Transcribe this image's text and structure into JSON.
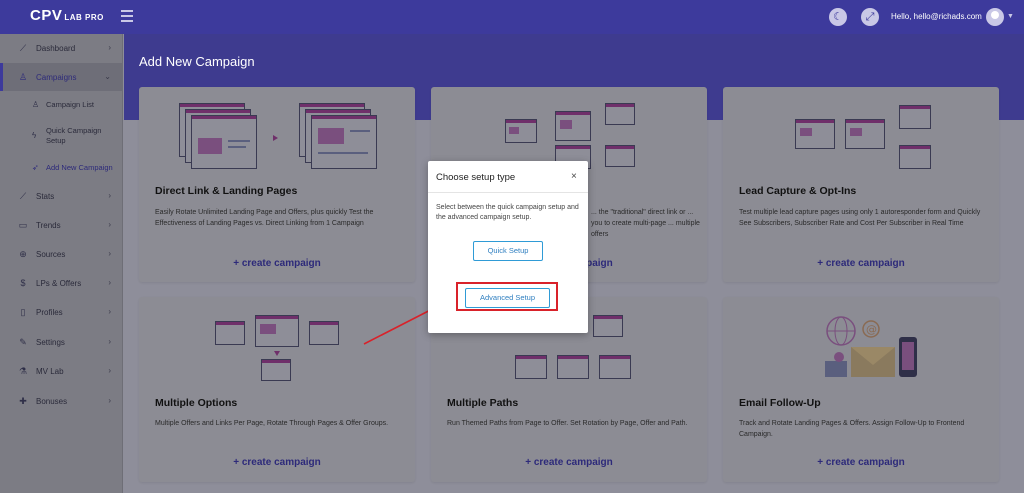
{
  "app": {
    "logo_main": "CPV",
    "logo_sub": "LAB PRO",
    "user_greeting": "Hello, hello@richads.com"
  },
  "sidebar": {
    "items": [
      {
        "label": "Dashboard",
        "icon": "chart-line-icon"
      },
      {
        "label": "Campaigns",
        "icon": "person-icon"
      },
      {
        "label": "Stats",
        "icon": "stats-icon"
      },
      {
        "label": "Trends",
        "icon": "trends-icon"
      },
      {
        "label": "Sources",
        "icon": "globe-icon"
      },
      {
        "label": "LPs & Offers",
        "icon": "dollar-icon"
      },
      {
        "label": "Profiles",
        "icon": "file-icon"
      },
      {
        "label": "Settings",
        "icon": "wrench-icon"
      },
      {
        "label": "MV Lab",
        "icon": "lab-icon"
      },
      {
        "label": "Bonuses",
        "icon": "gift-icon"
      }
    ],
    "subitems": [
      {
        "label": "Campaign List"
      },
      {
        "label": "Quick Campaign Setup"
      },
      {
        "label": "Add New Campaign"
      }
    ]
  },
  "main": {
    "title": "Add New Campaign",
    "cards": [
      {
        "title": "Direct Link & Landing Pages",
        "desc": "Easily Rotate Unlimited Landing Page and Offers, plus quickly Test the Effectiveness of Landing Pages vs. Direct Linking from 1 Campaign",
        "link": "+ create campaign"
      },
      {
        "title": "",
        "desc": "... the \"traditional\" direct link or ... you to create multi-page ... multiple offers",
        "link": "+ create campaign"
      },
      {
        "title": "Lead Capture & Opt-Ins",
        "desc": "Test multiple lead capture pages using only 1 autoresponder form and Quickly See Subscribers, Subscriber Rate and Cost Per Subscriber in Real Time",
        "link": "+ create campaign"
      },
      {
        "title": "Multiple Options",
        "desc": "Multiple Offers and Links Per Page, Rotate Through Pages & Offer Groups.",
        "link": "+ create campaign"
      },
      {
        "title": "Multiple Paths",
        "desc": "Run Themed Paths from Page to Offer. Set Rotation by Page, Offer and Path.",
        "link": "+ create campaign"
      },
      {
        "title": "Email Follow-Up",
        "desc": "Track and Rotate Landing Pages & Offers. Assign Follow-Up to Frontend Campaign.",
        "link": "+ create campaign"
      }
    ]
  },
  "modal": {
    "title": "Choose setup type",
    "close": "×",
    "body": "Select between the quick campaign setup and the advanced campaign setup.",
    "quick_label": "Quick Setup",
    "advanced_label": "Advanced Setup"
  },
  "colors": {
    "accent": "#3d3a9c",
    "link": "#2d2a7a",
    "highlight": "#d9222a",
    "button_border": "#2f9bd6"
  }
}
